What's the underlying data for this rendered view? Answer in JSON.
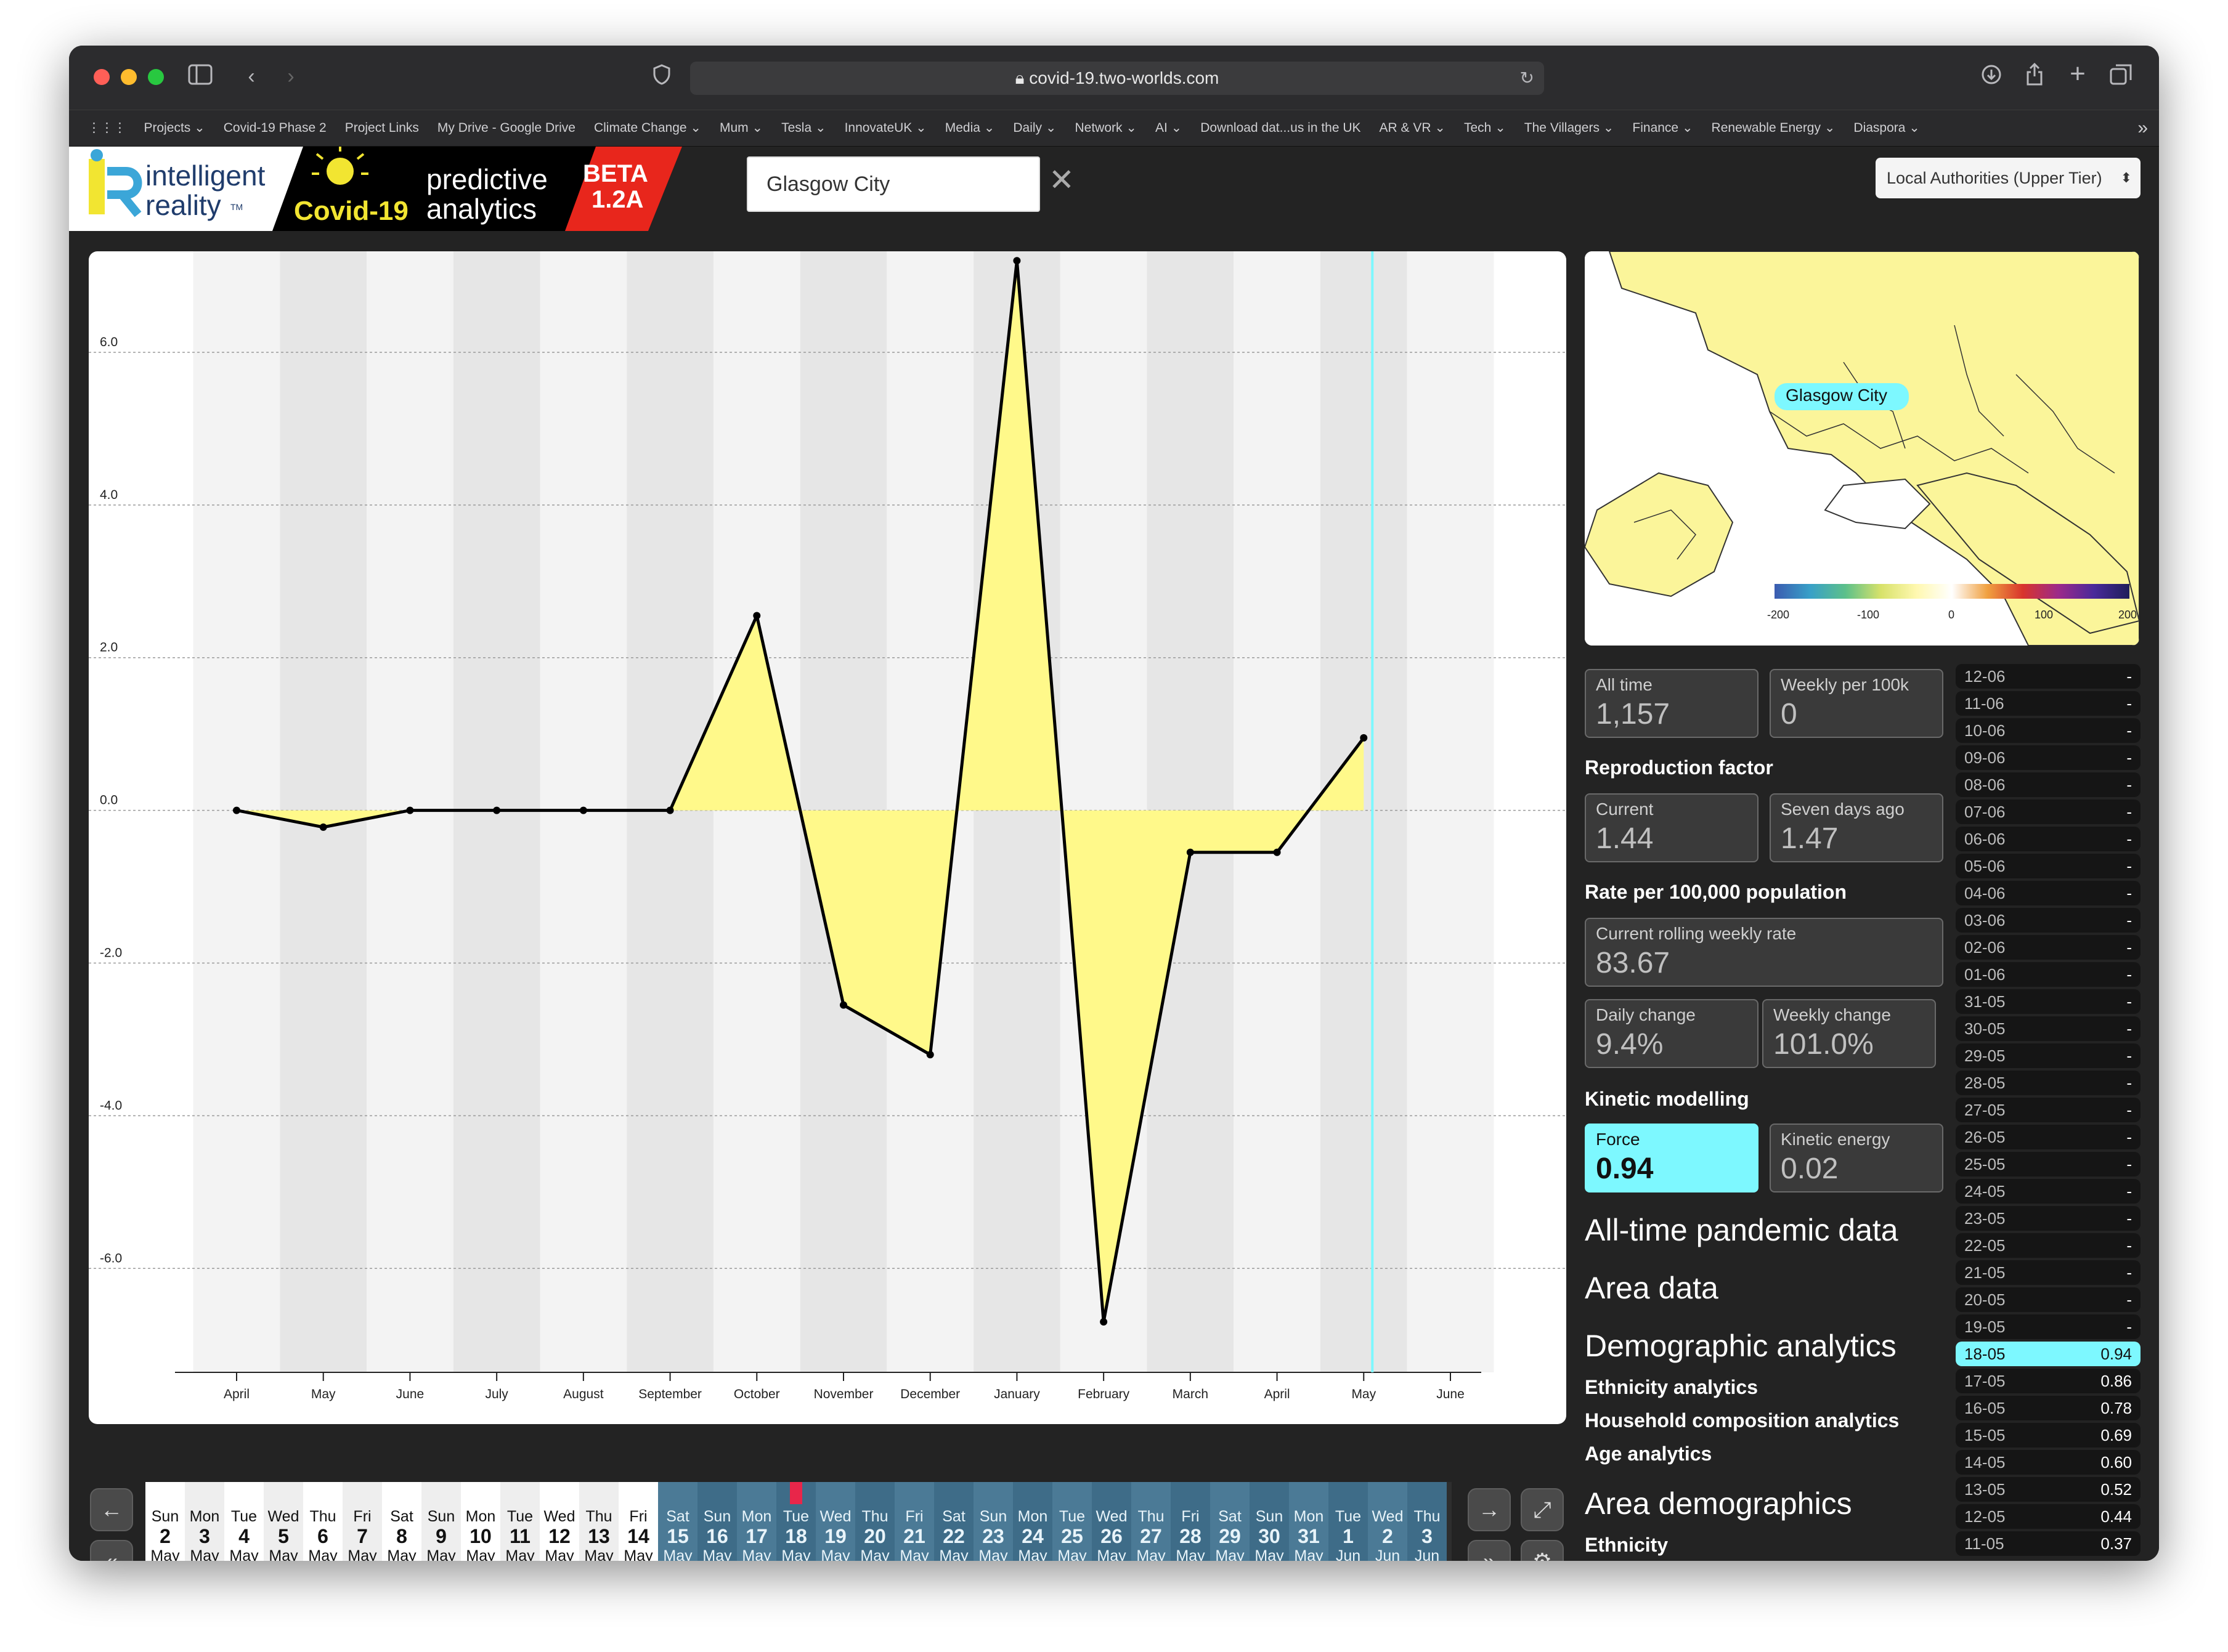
{
  "browser": {
    "url": "covid-19.two-worlds.com",
    "bookmarks": [
      "Projects ⌄",
      "Covid-19 Phase 2",
      "Project Links",
      "My Drive - Google Drive",
      "Climate Change ⌄",
      "Mum ⌄",
      "Tesla ⌄",
      "InnovateUK ⌄",
      "Media ⌄",
      "Daily ⌄",
      "Network ⌄",
      "AI ⌄",
      "Download dat...us in the UK",
      "AR & VR ⌄",
      "Tech ⌄",
      "The Villagers ⌄",
      "Finance ⌄",
      "Renewable Energy ⌄",
      "Diaspora ⌄"
    ]
  },
  "header": {
    "logo_top": "intelligent",
    "logo_bottom": "reality",
    "logo_tm": "TM",
    "covid_label": "Covid-19",
    "predictive": "predictive",
    "analytics": "analytics",
    "beta": "BETA",
    "version": "1.2A",
    "search_value": "Glasgow City",
    "clear_glyph": "✕",
    "area_type": "Local Authorities (Upper Tier)"
  },
  "chart_data": {
    "type": "area",
    "series": [
      {
        "x": [
          "April",
          "May",
          "June",
          "July",
          "August",
          "September",
          "October",
          "November",
          "December",
          "January",
          "February",
          "March",
          "April",
          "May"
        ],
        "values": [
          0.0,
          -0.22,
          0.0,
          0.0,
          0.0,
          0.0,
          2.55,
          -2.55,
          -3.2,
          7.2,
          -6.7,
          -0.55,
          -0.55,
          0.95
        ]
      }
    ],
    "ylim": [
      -7.2,
      7.0
    ],
    "y_ticks": [
      "6.0",
      "4.0",
      "2.0",
      "0.0",
      "-2.0",
      "-4.0",
      "-6.0"
    ],
    "x_ticks": [
      "April",
      "May",
      "June",
      "July",
      "August",
      "September",
      "October",
      "November",
      "December",
      "January",
      "February",
      "March",
      "April",
      "May",
      "June"
    ],
    "fill_color": "#fff98a",
    "line_color": "#000000",
    "marker_color": "#7df8ff"
  },
  "map": {
    "tooltip": "Glasgow City",
    "scale_ticks": [
      "-200",
      "-100",
      "0",
      "100",
      "200"
    ]
  },
  "stats": {
    "all_time_label": "All time",
    "all_time_value": "1,157",
    "weekly100k_label": "Weekly per 100k",
    "weekly100k_value": "0",
    "reproduction_heading": "Reproduction factor",
    "current_label": "Current",
    "current_value": "1.44",
    "seven_label": "Seven days ago",
    "seven_value": "1.47",
    "rate_heading": "Rate per 100,000 population",
    "rolling_label": "Current rolling weekly rate",
    "rolling_value": "83.67",
    "daily_label": "Daily change",
    "daily_value": "9.4%",
    "weekly_label": "Weekly change",
    "weekly_value": "101.0%",
    "kinetic_heading": "Kinetic modelling",
    "force_label": "Force",
    "force_value": "0.94",
    "energy_label": "Kinetic energy",
    "energy_value": "0.02"
  },
  "sections": {
    "all_time": "All-time pandemic data",
    "area_data": "Area data",
    "demographic": "Demographic analytics",
    "ethnicity_analytics": "Ethnicity analytics",
    "household": "Household composition analytics",
    "age": "Age analytics",
    "area_demo": "Area demographics",
    "ethnicity": "Ethnicity"
  },
  "dates": [
    {
      "d": "12-06",
      "v": "-"
    },
    {
      "d": "11-06",
      "v": "-"
    },
    {
      "d": "10-06",
      "v": "-"
    },
    {
      "d": "09-06",
      "v": "-"
    },
    {
      "d": "08-06",
      "v": "-"
    },
    {
      "d": "07-06",
      "v": "-"
    },
    {
      "d": "06-06",
      "v": "-"
    },
    {
      "d": "05-06",
      "v": "-"
    },
    {
      "d": "04-06",
      "v": "-"
    },
    {
      "d": "03-06",
      "v": "-"
    },
    {
      "d": "02-06",
      "v": "-"
    },
    {
      "d": "01-06",
      "v": "-"
    },
    {
      "d": "31-05",
      "v": "-"
    },
    {
      "d": "30-05",
      "v": "-"
    },
    {
      "d": "29-05",
      "v": "-"
    },
    {
      "d": "28-05",
      "v": "-"
    },
    {
      "d": "27-05",
      "v": "-"
    },
    {
      "d": "26-05",
      "v": "-"
    },
    {
      "d": "25-05",
      "v": "-"
    },
    {
      "d": "24-05",
      "v": "-"
    },
    {
      "d": "23-05",
      "v": "-"
    },
    {
      "d": "22-05",
      "v": "-"
    },
    {
      "d": "21-05",
      "v": "-"
    },
    {
      "d": "20-05",
      "v": "-"
    },
    {
      "d": "19-05",
      "v": "-"
    },
    {
      "d": "18-05",
      "v": "0.94",
      "selected": true
    },
    {
      "d": "17-05",
      "v": "0.86"
    },
    {
      "d": "16-05",
      "v": "0.78"
    },
    {
      "d": "15-05",
      "v": "0.69"
    },
    {
      "d": "14-05",
      "v": "0.60"
    },
    {
      "d": "13-05",
      "v": "0.52"
    },
    {
      "d": "12-05",
      "v": "0.44"
    },
    {
      "d": "11-05",
      "v": "0.37"
    }
  ],
  "strip": [
    {
      "n": "Sun",
      "d": "2",
      "m": "May"
    },
    {
      "n": "Mon",
      "d": "3",
      "m": "May"
    },
    {
      "n": "Tue",
      "d": "4",
      "m": "May"
    },
    {
      "n": "Wed",
      "d": "5",
      "m": "May"
    },
    {
      "n": "Thu",
      "d": "6",
      "m": "May"
    },
    {
      "n": "Fri",
      "d": "7",
      "m": "May"
    },
    {
      "n": "Sat",
      "d": "8",
      "m": "May"
    },
    {
      "n": "Sun",
      "d": "9",
      "m": "May"
    },
    {
      "n": "Mon",
      "d": "10",
      "m": "May"
    },
    {
      "n": "Tue",
      "d": "11",
      "m": "May"
    },
    {
      "n": "Wed",
      "d": "12",
      "m": "May"
    },
    {
      "n": "Thu",
      "d": "13",
      "m": "May"
    },
    {
      "n": "Fri",
      "d": "14",
      "m": "May"
    },
    {
      "n": "Sat",
      "d": "15",
      "m": "May"
    },
    {
      "n": "Sun",
      "d": "16",
      "m": "May"
    },
    {
      "n": "Mon",
      "d": "17",
      "m": "May"
    },
    {
      "n": "Tue",
      "d": "18",
      "m": "May"
    },
    {
      "n": "Wed",
      "d": "19",
      "m": "May"
    },
    {
      "n": "Thu",
      "d": "20",
      "m": "May"
    },
    {
      "n": "Fri",
      "d": "21",
      "m": "May"
    },
    {
      "n": "Sat",
      "d": "22",
      "m": "May"
    },
    {
      "n": "Sun",
      "d": "23",
      "m": "May"
    },
    {
      "n": "Mon",
      "d": "24",
      "m": "May"
    },
    {
      "n": "Tue",
      "d": "25",
      "m": "May"
    },
    {
      "n": "Wed",
      "d": "26",
      "m": "May"
    },
    {
      "n": "Thu",
      "d": "27",
      "m": "May"
    },
    {
      "n": "Fri",
      "d": "28",
      "m": "May"
    },
    {
      "n": "Sat",
      "d": "29",
      "m": "May"
    },
    {
      "n": "Sun",
      "d": "30",
      "m": "May"
    },
    {
      "n": "Mon",
      "d": "31",
      "m": "May"
    },
    {
      "n": "Tue",
      "d": "1",
      "m": "Jun"
    },
    {
      "n": "Wed",
      "d": "2",
      "m": "Jun"
    },
    {
      "n": "Thu",
      "d": "3",
      "m": "Jun"
    }
  ],
  "icons": {
    "prev": "←",
    "prev_fast": "«",
    "next": "→",
    "next_fast": "»",
    "expand": "⤢",
    "settings": "⚙",
    "back": "‹",
    "forward": "›",
    "reload": "↻"
  }
}
